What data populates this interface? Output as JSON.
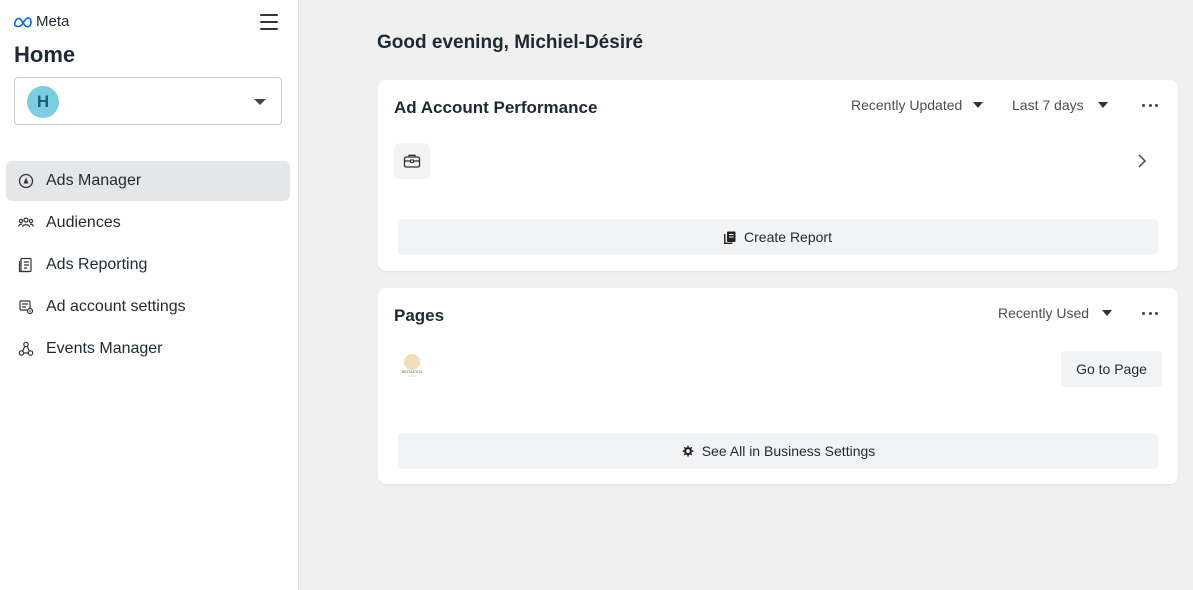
{
  "brand": {
    "name": "Meta"
  },
  "sidebar": {
    "title": "Home",
    "account": {
      "avatar_letter": "H"
    },
    "items": [
      {
        "label": "Ads Manager",
        "icon": "ads-manager-icon",
        "active": true
      },
      {
        "label": "Audiences",
        "icon": "audiences-icon"
      },
      {
        "label": "Ads Reporting",
        "icon": "ads-reporting-icon"
      },
      {
        "label": "Ad account settings",
        "icon": "ad-account-settings-icon"
      },
      {
        "label": "Events Manager",
        "icon": "events-manager-icon"
      }
    ]
  },
  "main": {
    "greeting": "Good evening, Michiel-Désiré",
    "ad_performance": {
      "title": "Ad Account Performance",
      "sort_label": "Recently Updated",
      "range_label": "Last 7 days",
      "create_report_label": "Create Report"
    },
    "pages": {
      "title": "Pages",
      "sort_label": "Recently Used",
      "page_thumb_text": "BRITANNIA",
      "go_to_page_label": "Go to Page",
      "see_all_label": "See All in Business Settings"
    }
  },
  "colors": {
    "avatar_bg": "#7ccde0",
    "active_nav_bg": "#e4e6e8",
    "main_bg": "#f0f0f0"
  }
}
